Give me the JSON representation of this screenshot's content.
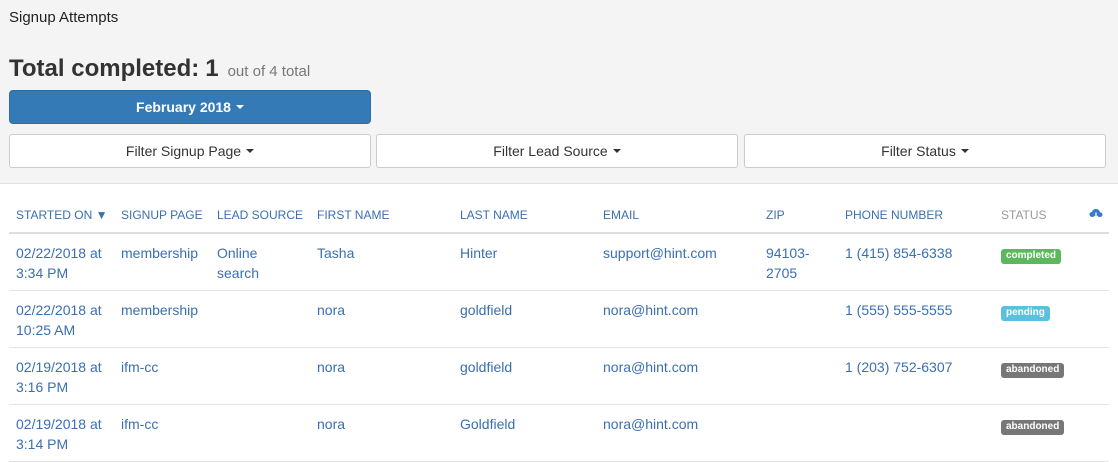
{
  "page_title": "Signup Attempts",
  "summary": {
    "label": "Total completed:",
    "count": "1",
    "sub": "out of 4 total"
  },
  "month_selector": "February 2018",
  "filters": {
    "signup_page": "Filter Signup Page",
    "lead_source": "Filter Lead Source",
    "status": "Filter Status"
  },
  "columns": {
    "started_on": "STARTED ON ▼",
    "signup_page": "SIGNUP PAGE",
    "lead_source": "LEAD SOURCE",
    "first_name": "FIRST NAME",
    "last_name": "LAST NAME",
    "email": "EMAIL",
    "zip": "ZIP",
    "phone": "PHONE NUMBER",
    "status": "STATUS",
    "download_icon": "cloud-download-icon"
  },
  "rows": [
    {
      "date": "02/22/2018 at",
      "time": "3:34 PM",
      "signup_page": "membership",
      "lead_source_1": "Online",
      "lead_source_2": "search",
      "first_name": "Tasha",
      "last_name": "Hinter",
      "email": "support@hint.com",
      "zip_1": "94103-",
      "zip_2": "2705",
      "phone": "1 (415) 854-6338",
      "status": "completed",
      "status_color": "#5cb85c"
    },
    {
      "date": "02/22/2018 at",
      "time": "10:25 AM",
      "signup_page": "membership",
      "lead_source_1": "",
      "lead_source_2": "",
      "first_name": "nora",
      "last_name": "goldfield",
      "email": "nora@hint.com",
      "zip_1": "",
      "zip_2": "",
      "phone": "1 (555) 555-5555",
      "status": "pending",
      "status_color": "#5bc0de"
    },
    {
      "date": "02/19/2018 at",
      "time": "3:16 PM",
      "signup_page": "ifm-cc",
      "lead_source_1": "",
      "lead_source_2": "",
      "first_name": "nora",
      "last_name": "goldfield",
      "email": "nora@hint.com",
      "zip_1": "",
      "zip_2": "",
      "phone": "1 (203) 752-6307",
      "status": "abandoned",
      "status_color": "#777777"
    },
    {
      "date": "02/19/2018 at",
      "time": "3:14 PM",
      "signup_page": "ifm-cc",
      "lead_source_1": "",
      "lead_source_2": "",
      "first_name": "nora",
      "last_name": "Goldfield",
      "email": "nora@hint.com",
      "zip_1": "",
      "zip_2": "",
      "phone": "",
      "status": "abandoned",
      "status_color": "#777777"
    }
  ]
}
